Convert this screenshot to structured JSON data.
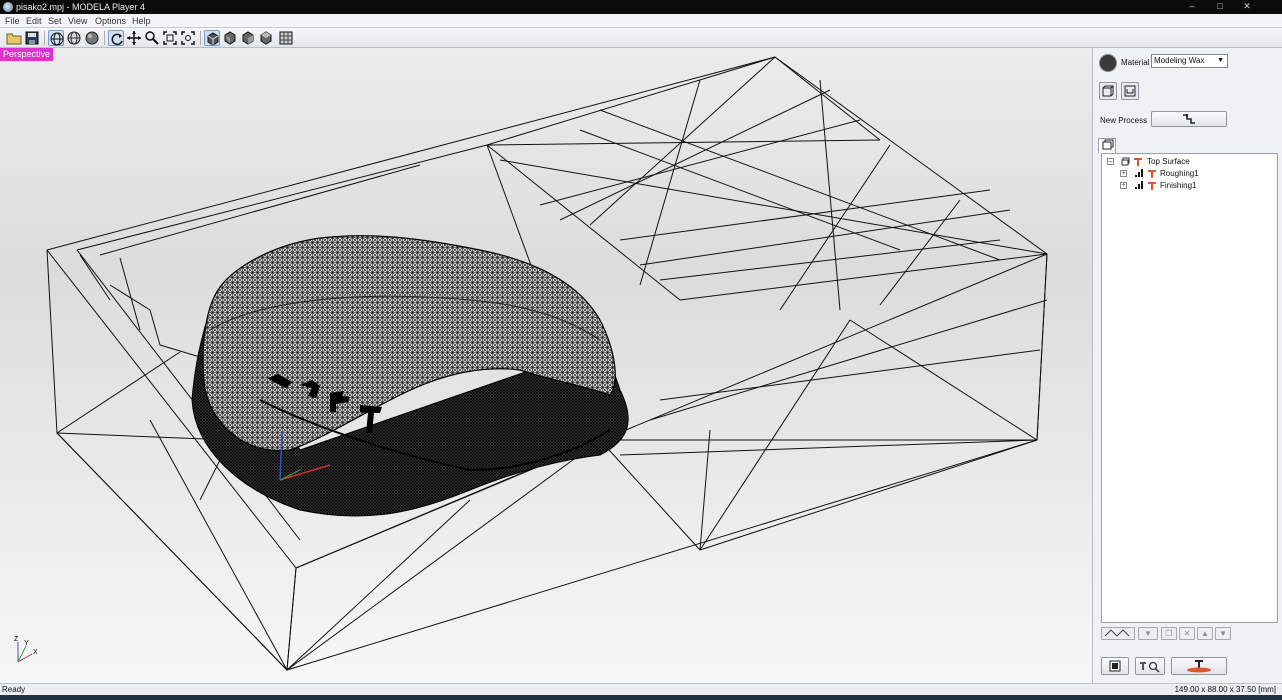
{
  "window": {
    "title": "pisako2.mpj - MODELA Player 4"
  },
  "menu": [
    "File",
    "Edit",
    "Set",
    "View",
    "Options",
    "Help"
  ],
  "viewport": {
    "view_label": "Perspective",
    "axes": {
      "z": "Z",
      "y": "Y",
      "x": "X"
    }
  },
  "panel": {
    "material_label": "Material",
    "material_value": "Modeling Wax",
    "new_process_label": "New Process",
    "tree": {
      "root": "Top Surface",
      "children": [
        "Roughing1",
        "Finishing1"
      ]
    }
  },
  "status": {
    "left": "Ready",
    "dimensions": "149.00 x 88.00 x 37.50 [mm]"
  },
  "colors": {
    "perspective_badge": "#e12fd3",
    "title_bar": "#0b0b0c",
    "process_icon": "#e0562a"
  }
}
